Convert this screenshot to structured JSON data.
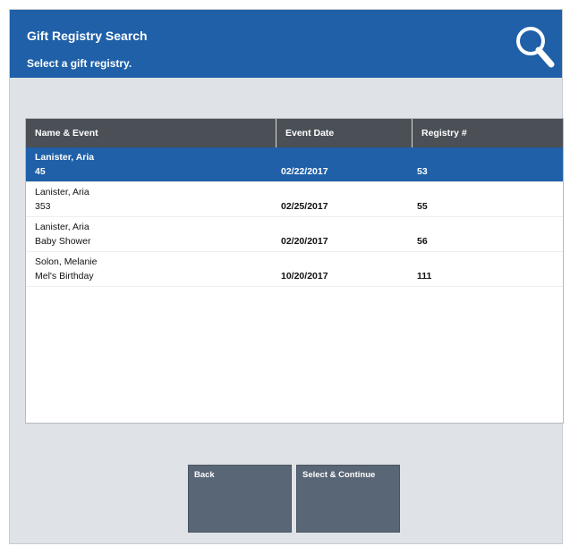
{
  "header": {
    "title": "Gift Registry Search",
    "subtitle": "Select a gift registry."
  },
  "icon": "search-icon",
  "colors": {
    "header": "#1f60a8",
    "selected_row": "#1f60a8",
    "table_header": "#4b4f56",
    "button": "#596675",
    "background": "#dfe2e6"
  },
  "table": {
    "columns": [
      "Name & Event",
      "Event Date",
      "Registry #"
    ],
    "rows": [
      {
        "name": "Lanister, Aria",
        "event": "45",
        "date": "02/22/2017",
        "registry": "53",
        "selected": true
      },
      {
        "name": "Lanister, Aria",
        "event": "353",
        "date": "02/25/2017",
        "registry": "55",
        "selected": false
      },
      {
        "name": "Lanister, Aria",
        "event": "Baby Shower",
        "date": "02/20/2017",
        "registry": "56",
        "selected": false
      },
      {
        "name": "Solon, Melanie",
        "event": "Mel's Birthday",
        "date": "10/20/2017",
        "registry": "111",
        "selected": false
      }
    ]
  },
  "buttons": {
    "back": "Back",
    "select_continue": "Select & Continue"
  }
}
